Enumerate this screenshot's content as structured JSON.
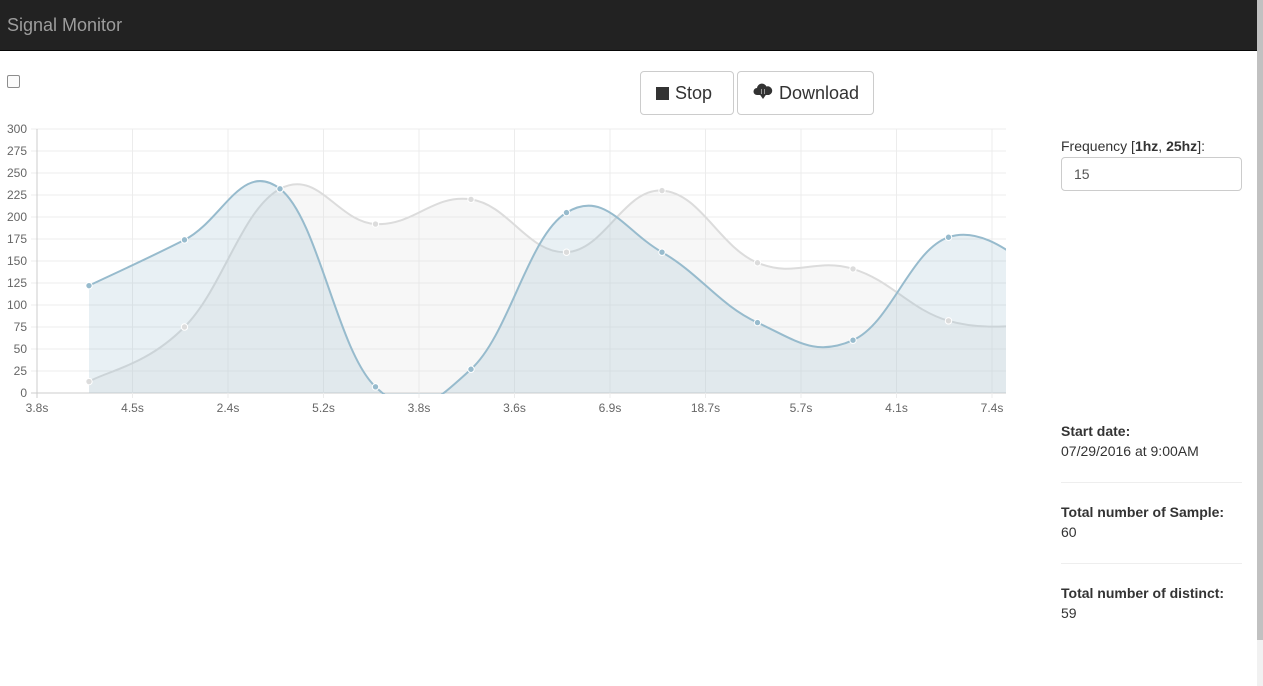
{
  "app": {
    "title": "Signal Monitor"
  },
  "toolbar": {
    "stop_label": "Stop",
    "download_label": "Download"
  },
  "frequency": {
    "label_prefix": "Frequency [",
    "min": "1hz",
    "separator": ", ",
    "max": "25hz",
    "label_suffix": "]:",
    "value": "15"
  },
  "info": {
    "start_date_label": "Start date:",
    "start_date_value": "07/29/2016 at 9:00AM",
    "samples_label": "Total number of Sample:",
    "samples_value": "60",
    "distinct_label": "Total number of distinct:",
    "distinct_value": "59"
  },
  "colors": {
    "navbar": "#222222",
    "series_blue": "#97bbcd",
    "series_gray": "#dcdcdc"
  },
  "chart_data": {
    "type": "line",
    "categories": [
      "3.8s",
      "4.5s",
      "2.4s",
      "5.2s",
      "3.8s",
      "3.6s",
      "6.9s",
      "18.7s",
      "5.7s",
      "4.1s",
      "7.4s"
    ],
    "ylim": [
      0,
      300
    ],
    "yticks": [
      0,
      25,
      50,
      75,
      100,
      125,
      150,
      175,
      200,
      225,
      250,
      275,
      300
    ],
    "grid": true,
    "series": [
      {
        "color": "#97bbcd",
        "values": [
          122,
          174,
          232,
          7,
          27,
          205,
          160,
          80,
          60,
          177,
          135
        ]
      },
      {
        "color": "#dcdcdc",
        "values": [
          13,
          75,
          232,
          192,
          220,
          160,
          230,
          148,
          141,
          82,
          78
        ]
      }
    ]
  }
}
